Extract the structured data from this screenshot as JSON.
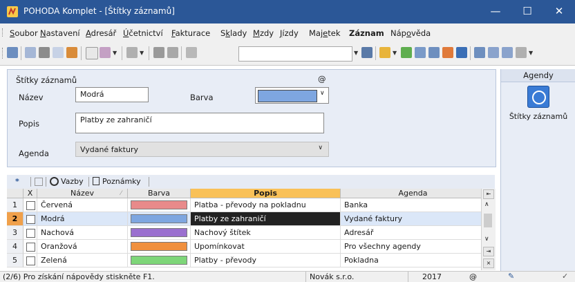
{
  "window": {
    "title": "POHODA Komplet - [Štítky záznamů]",
    "controls": [
      "—",
      "☐",
      "✕"
    ]
  },
  "menu": [
    {
      "label": "Soubor",
      "u": "S",
      "rest": "oubor"
    },
    {
      "label": "Nastavení",
      "u": "N",
      "rest": "astavení"
    },
    {
      "label": "Adresář",
      "u": "A",
      "rest": "dresář"
    },
    {
      "label": "Účetnictví",
      "u": "Ú",
      "rest": "četnictví"
    },
    {
      "label": "Fakturace",
      "u": "F",
      "rest": "akturace"
    },
    {
      "label": "Sklady",
      "u": "S",
      "rest": "klady"
    },
    {
      "label": "Mzdy",
      "u": "M",
      "rest": "zdy"
    },
    {
      "label": "Jízdy",
      "u": "J",
      "rest": "ízdy"
    },
    {
      "label": "Majetek",
      "u": "e",
      "rest": ""
    },
    {
      "label": "Záznam",
      "u": "",
      "rest": ""
    },
    {
      "label": "Nápověda",
      "u": "o",
      "rest": ""
    }
  ],
  "form": {
    "section_title": "Štítky záznamů",
    "at_symbol": "@",
    "nazev_label": "Název",
    "nazev_value": "Modrá",
    "barva_label": "Barva",
    "barva_color": "#7ea6e0",
    "popis_label": "Popis",
    "popis_value": "Platby ze zahraničí",
    "agenda_label": "Agenda",
    "agenda_value": "Vydané faktury"
  },
  "agendy": {
    "header": "Agendy",
    "item_label": "Štítky záznamů",
    "item_icon": "agenda-tag-icon"
  },
  "tabs": {
    "star": "*",
    "vazby": "Vazby",
    "poznamky": "Poznámky"
  },
  "grid": {
    "columns": [
      "X",
      "Název",
      "Barva",
      "Popis",
      "Agenda"
    ],
    "sort_mark": "⁄",
    "rows": [
      {
        "num": "1",
        "name": "Červená",
        "color": "#e88a8a",
        "popis": "Platba - převody na pokladnu",
        "agenda": "Banka"
      },
      {
        "num": "2",
        "name": "Modrá",
        "color": "#7ea6e0",
        "popis": "Platby ze zahraničí",
        "agenda": "Vydané faktury"
      },
      {
        "num": "3",
        "name": "Nachová",
        "color": "#9a6fcf",
        "popis": "Nachový štítek",
        "agenda": "Adresář"
      },
      {
        "num": "4",
        "name": "Oranžová",
        "color": "#f0903e",
        "popis": "Upomínkovat",
        "agenda": "Pro všechny agendy"
      },
      {
        "num": "5",
        "name": "Zelená",
        "color": "#7ed679",
        "popis": "Platby - převody",
        "agenda": "Pokladna"
      }
    ]
  },
  "status": {
    "hint": "(2/6) Pro získání nápovědy stiskněte F1.",
    "company": "Novák s.r.o.",
    "year": "2017",
    "at": "@"
  }
}
